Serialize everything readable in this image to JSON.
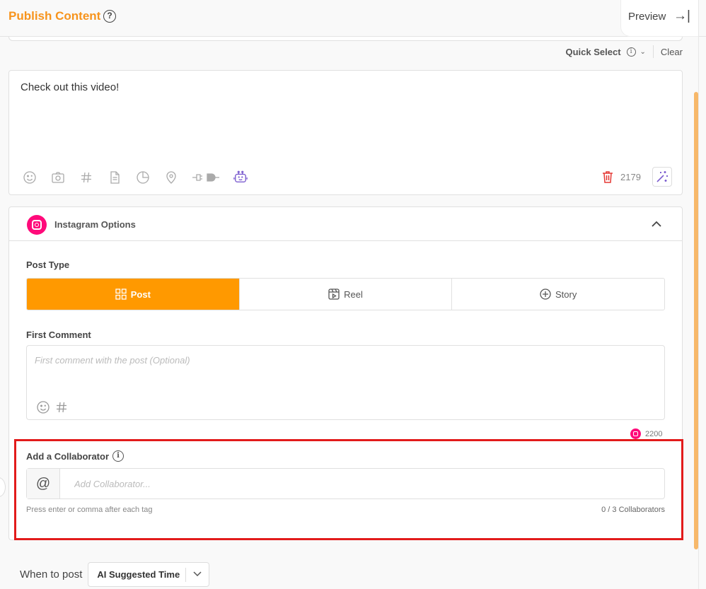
{
  "header": {
    "title": "Publish Content",
    "help_icon": "?",
    "preview_label": "Preview",
    "preview_icon": "→|"
  },
  "quick_select": {
    "label": "Quick Select",
    "info_icon": "i",
    "chevron": "⌄",
    "clear_label": "Clear"
  },
  "editor": {
    "text": "Check out this video!",
    "tools": [
      "emoji-icon",
      "camera-icon",
      "hashtag-icon",
      "document-icon",
      "pie-chart-icon",
      "location-icon",
      "plug-icon",
      "ai-bot-icon"
    ],
    "char_count": "2179"
  },
  "instagram": {
    "title": "Instagram Options",
    "collapse_icon": "^",
    "post_type_label": "Post Type",
    "post_types": [
      {
        "label": "Post",
        "active": true
      },
      {
        "label": "Reel",
        "active": false
      },
      {
        "label": "Story",
        "active": false
      }
    ],
    "first_comment_label": "First Comment",
    "first_comment_placeholder": "First comment with the post (Optional)",
    "comment_char_count": "2200",
    "collaborator_label": "Add a Collaborator",
    "collaborator_info_icon": "i",
    "at_symbol": "@",
    "collaborator_placeholder": "Add Collaborator...",
    "collaborator_hint": "Press enter or comma after each tag",
    "collaborator_count": "0 / 3 Collaborators"
  },
  "when_to_post": {
    "label": "When to post",
    "value": "AI Suggested Time",
    "chevron": "⌄"
  },
  "colors": {
    "brand_orange": "#f7941d",
    "active_tab": "#ff9900",
    "instagram_pink": "#ff0a7a",
    "highlight_red": "#e21b1b",
    "ai_purple": "#7b5ccf"
  }
}
